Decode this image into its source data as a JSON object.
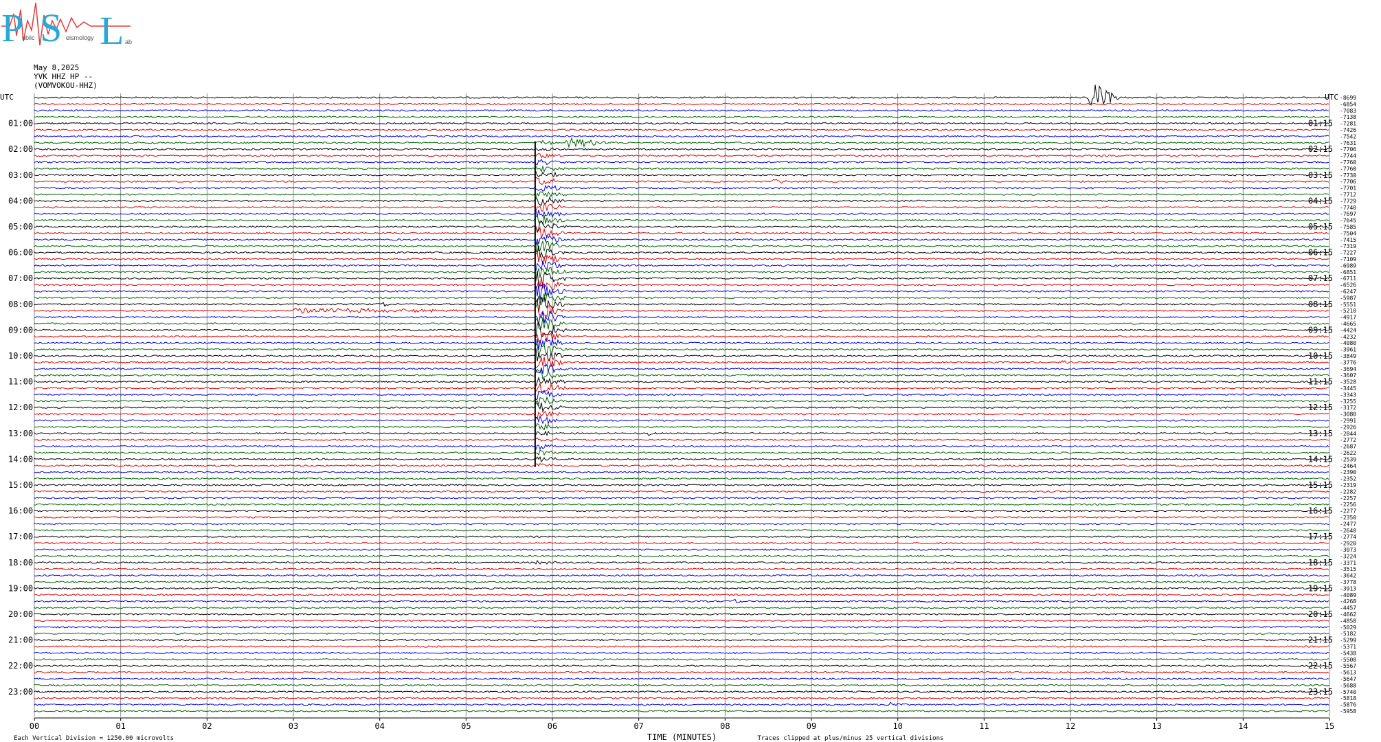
{
  "logo": {
    "letters": [
      "P",
      "S",
      "L"
    ],
    "words": [
      "ublic",
      "eismology",
      "ab"
    ]
  },
  "header": {
    "date": "May 8,2025",
    "channel": "YVK HHZ HP --",
    "station": "(VOMVOKOU-HHZ)"
  },
  "colors": {
    "trace_cycle": [
      "#000000",
      "#e00000",
      "#0000e0",
      "#006400"
    ],
    "grid": "#888888",
    "logo": "#2aa9d8",
    "logo_accent": "#e23a3a"
  },
  "chart_data": {
    "type": "line",
    "title": "",
    "xlabel": "TIME (MINUTES)",
    "ylabel": "",
    "x_ticks": [
      "00",
      "01",
      "02",
      "03",
      "04",
      "05",
      "06",
      "07",
      "08",
      "09",
      "10",
      "11",
      "12",
      "13",
      "14",
      "15"
    ],
    "xlim": [
      0,
      15
    ],
    "left_axis_title": "UTC",
    "right_axis_title": "UTC",
    "left_hours": [
      "01:00",
      "02:00",
      "03:00",
      "04:00",
      "05:00",
      "06:00",
      "07:00",
      "08:00",
      "09:00",
      "10:00",
      "11:00",
      "12:00",
      "13:00",
      "14:00",
      "15:00",
      "16:00",
      "17:00",
      "18:00",
      "19:00",
      "20:00",
      "21:00",
      "22:00",
      "23:00"
    ],
    "right_hours": [
      "01:15",
      "02:15",
      "03:15",
      "04:15",
      "05:15",
      "06:15",
      "07:15",
      "08:15",
      "09:15",
      "10:15",
      "11:15",
      "12:15",
      "13:15",
      "14:15",
      "15:15",
      "16:15",
      "17:15",
      "18:15",
      "19:15",
      "20:15",
      "21:15",
      "22:15",
      "23:15"
    ],
    "trace_count": 96,
    "traces_per_hour": 4,
    "trace_offsets": [
      -8699,
      -6854,
      -7083,
      -7138,
      -7281,
      -7426,
      -7542,
      -7631,
      -7706,
      -7744,
      -7760,
      -7760,
      -7730,
      -7706,
      -7701,
      -7712,
      -7729,
      -7740,
      -7697,
      -7645,
      -7585,
      -7504,
      -7415,
      -7319,
      -7227,
      -7109,
      -6989,
      -6851,
      -6711,
      -6526,
      -6247,
      -5987,
      -5551,
      -5210,
      -4917,
      -4665,
      -4424,
      -4232,
      -4080,
      -3961,
      -3849,
      -3776,
      -3694,
      -3607,
      -3528,
      -3445,
      -3343,
      -3255,
      -3172,
      -3080,
      -2991,
      -2926,
      -2844,
      -2772,
      -2687,
      -2622,
      -2539,
      -2464,
      -2390,
      -2352,
      -2319,
      -2282,
      -2257,
      -2256,
      -2277,
      -2350,
      -2477,
      -2640,
      -2774,
      -2920,
      -3073,
      -3224,
      -3371,
      -3515,
      -3642,
      -3778,
      -3913,
      -4089,
      -4268,
      -4457,
      -4662,
      -4858,
      -5029,
      -5182,
      -5299,
      -5371,
      -5438,
      -5508,
      -5567,
      -5613,
      -5647,
      -5688,
      -5740,
      -5818,
      -5876,
      -5958
    ],
    "events": [
      {
        "trace": 0,
        "minute": 12.2,
        "duration": 0.4,
        "amplitude": 2.5
      },
      {
        "trace": 7,
        "minute": 6.15,
        "duration": 0.6,
        "amplitude": 0.8
      },
      {
        "trace": 13,
        "minute": 8.5,
        "duration": 0.3,
        "amplitude": 0.35
      },
      {
        "trace": 33,
        "minute": 3.0,
        "duration": 2.6,
        "amplitude": 0.4
      },
      {
        "trace": 32,
        "minute": 4.0,
        "duration": 0.2,
        "amplitude": 0.4
      },
      {
        "trace": 52,
        "minute": 7.1,
        "duration": 0.15,
        "amplitude": 0.4
      },
      {
        "trace": 72,
        "minute": 5.8,
        "duration": 0.3,
        "amplitude": 0.35
      },
      {
        "trace": 78,
        "minute": 8.1,
        "duration": 0.2,
        "amplitude": 0.35
      },
      {
        "trace": 94,
        "minute": 9.9,
        "duration": 0.2,
        "amplitude": 0.45
      },
      {
        "trace": 45,
        "minute": 10.0,
        "duration": 0.1,
        "amplitude": 0.3
      },
      {
        "trace": 41,
        "minute": 11.9,
        "duration": 0.1,
        "amplitude": 0.3
      }
    ],
    "main_event": {
      "minute": 5.8,
      "first_trace": 7,
      "last_trace": 57,
      "peak_trace": 32
    },
    "footer_left": "Each Vertical Division = 1250.00 microvolts",
    "footer_right": "Traces clipped at plus/minus 25 vertical divisions"
  }
}
